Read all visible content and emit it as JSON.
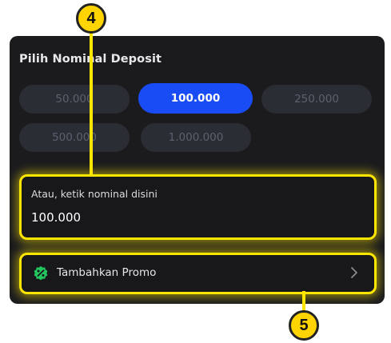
{
  "deposit": {
    "title": "Pilih Nominal Deposit",
    "options": [
      {
        "label": "50.000",
        "selected": false
      },
      {
        "label": "100.000",
        "selected": true
      },
      {
        "label": "250.000",
        "selected": false
      },
      {
        "label": "500.000",
        "selected": false
      },
      {
        "label": "1.000.000",
        "selected": false
      }
    ]
  },
  "custom_input": {
    "label": "Atau, ketik nominal disini",
    "value": "100.000"
  },
  "promo": {
    "label": "Tambahkan Promo",
    "icon": "percent-badge-icon",
    "chevron_icon": "chevron-right-icon"
  },
  "annotations": [
    {
      "number": "4"
    },
    {
      "number": "5"
    }
  ],
  "colors": {
    "background": "#1b1b1e",
    "chip": "#2a2d34",
    "selected_chip": "#1a4cf5",
    "highlight": "#ffe600",
    "promo_icon": "#22c55e"
  }
}
